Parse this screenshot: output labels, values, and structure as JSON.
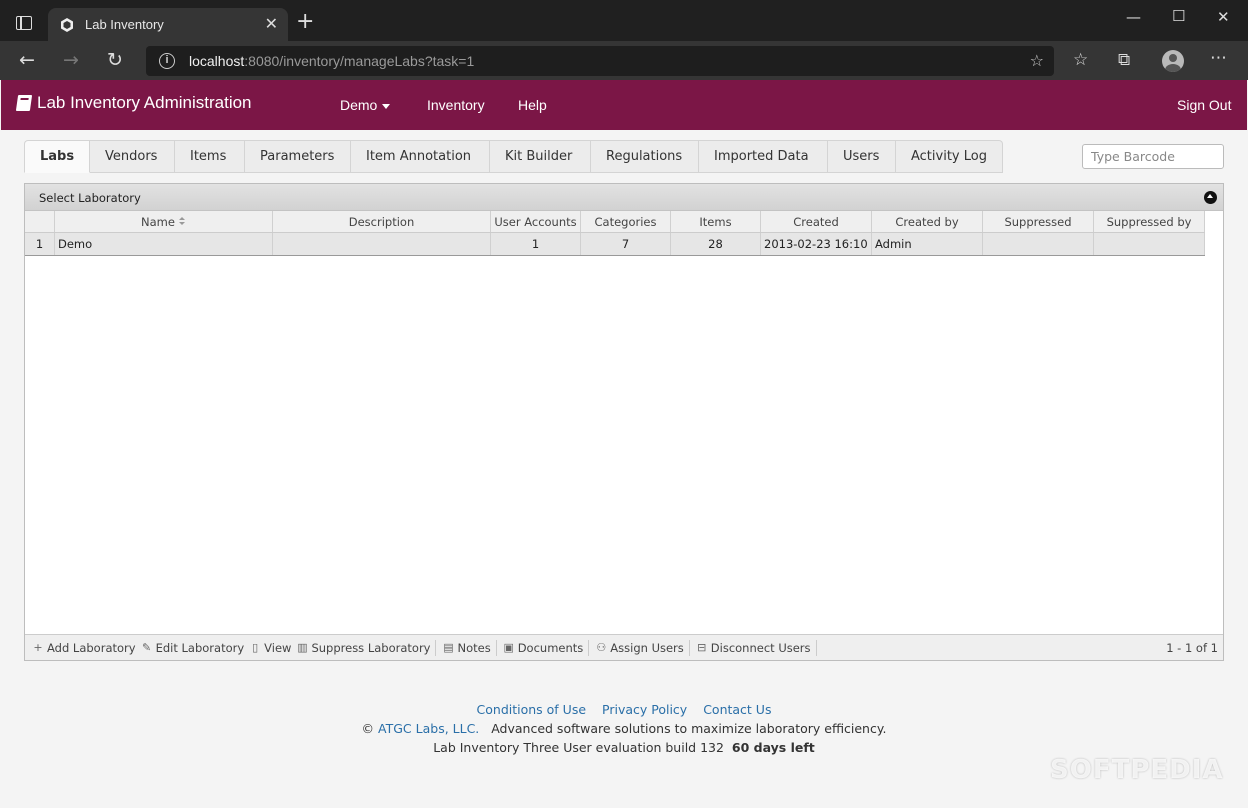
{
  "browser": {
    "tab_title": "Lab Inventory",
    "url_host": "localhost",
    "url_rest": ":8080/inventory/manageLabs?task=1"
  },
  "app": {
    "brand": "Lab Inventory Administration",
    "brand_color": "#7b1646",
    "nav": {
      "lab_select": "Demo",
      "inventory": "Inventory",
      "help": "Help",
      "sign_out": "Sign Out"
    }
  },
  "tabs": [
    "Labs",
    "Vendors",
    "Items",
    "Parameters",
    "Item Annotation",
    "Kit Builder",
    "Regulations",
    "Imported Data",
    "Users",
    "Activity Log"
  ],
  "active_tab": "Labs",
  "barcode": {
    "placeholder": "Type Barcode"
  },
  "grid": {
    "caption": "Select Laboratory",
    "columns": [
      "",
      "Name",
      "Description",
      "User Accounts",
      "Categories",
      "Items",
      "Created",
      "Created by",
      "Suppressed",
      "Suppressed by"
    ],
    "rows": [
      {
        "num": "1",
        "name": "Demo",
        "description": "",
        "user_accounts": "1",
        "categories": "7",
        "items": "28",
        "created": "2013-02-23 16:10",
        "created_by": "Admin",
        "suppressed": "",
        "suppressed_by": ""
      }
    ],
    "footer": {
      "add": "Add Laboratory",
      "edit": "Edit Laboratory",
      "view": "View",
      "suppress": "Suppress Laboratory",
      "notes": "Notes",
      "documents": "Documents",
      "assign": "Assign Users",
      "disconnect": "Disconnect Users",
      "pager": "1 - 1 of 1"
    }
  },
  "footer": {
    "conditions": "Conditions of Use",
    "privacy": "Privacy Policy",
    "contact": "Contact Us",
    "copyright": "©",
    "company": "ATGC Labs, LLC.",
    "tagline": "Advanced software solutions to maximize laboratory efficiency.",
    "build": "Lab Inventory Three User evaluation build 132",
    "days_left": "60 days left"
  },
  "watermark": "SOFTPEDIA"
}
